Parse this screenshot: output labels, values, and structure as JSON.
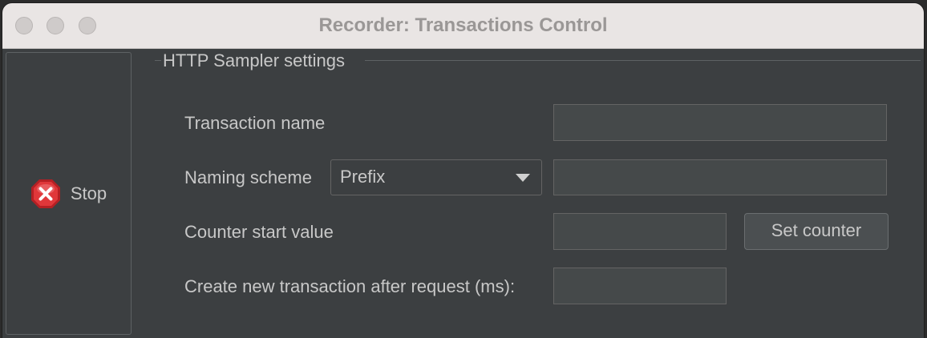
{
  "window": {
    "title": "Recorder: Transactions Control"
  },
  "stop": {
    "label": "Stop",
    "icon": "stop-icon",
    "icon_color": "#e0373a"
  },
  "sampler": {
    "legend": "HTTP Sampler settings",
    "transaction_name": {
      "label": "Transaction name",
      "value": ""
    },
    "naming_scheme": {
      "label": "Naming scheme",
      "selected": "Prefix",
      "value": ""
    },
    "counter_start": {
      "label": "Counter start value",
      "value": "",
      "button": "Set counter"
    },
    "new_transaction": {
      "label": "Create new transaction after request (ms):",
      "value": ""
    }
  }
}
